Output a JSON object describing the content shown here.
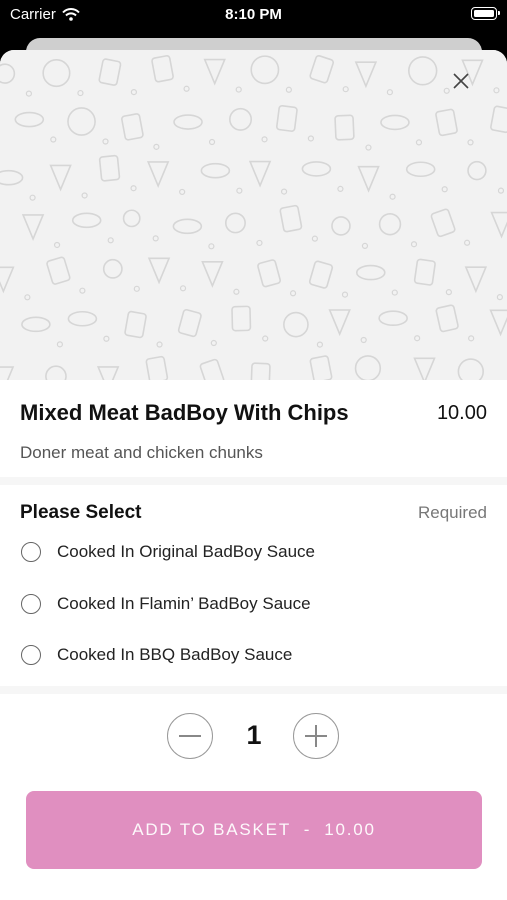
{
  "status_bar": {
    "carrier": "Carrier",
    "time": "8:10 PM"
  },
  "colors": {
    "accent": "#e08fc0",
    "hero_bg": "#f2f2f2",
    "doodle": "#d6d6d6"
  },
  "product": {
    "title": "Mixed Meat BadBoy With Chips",
    "price": "10.00",
    "description": "Doner meat and chicken chunks"
  },
  "options_section": {
    "title": "Please Select",
    "required_label": "Required",
    "options": [
      "Cooked In Original BadBoy Sauce",
      "Cooked In Flamin’ BadBoy Sauce",
      "Cooked In BBQ BadBoy Sauce"
    ]
  },
  "quantity": {
    "value": "1"
  },
  "add_button": {
    "label": "ADD TO BASKET  -  10.00"
  },
  "icons": {
    "close": "close-icon",
    "minus": "minus-icon",
    "plus": "plus-icon",
    "wifi": "wifi-icon",
    "battery": "battery-icon"
  }
}
